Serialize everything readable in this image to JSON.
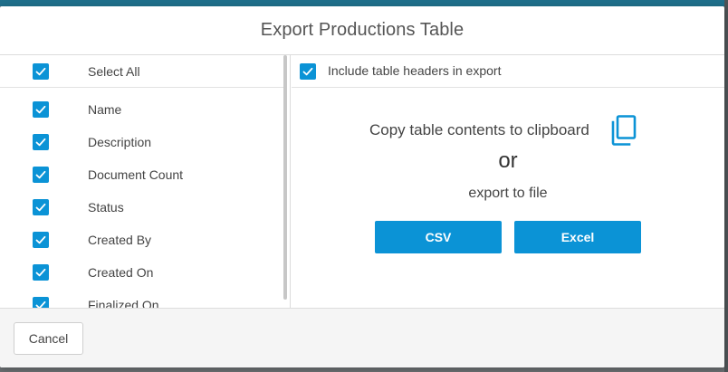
{
  "dialog": {
    "title": "Export Productions Table"
  },
  "columns": {
    "select_all": {
      "label": "Select All",
      "checked": true
    },
    "items": [
      {
        "label": "Name",
        "checked": true
      },
      {
        "label": "Description",
        "checked": true
      },
      {
        "label": "Document Count",
        "checked": true
      },
      {
        "label": "Status",
        "checked": true
      },
      {
        "label": "Created By",
        "checked": true
      },
      {
        "label": "Created On",
        "checked": true
      },
      {
        "label": "Finalized On",
        "checked": true
      }
    ]
  },
  "options": {
    "include_headers_label": "Include table headers in export",
    "include_headers_checked": true
  },
  "export": {
    "copy_text": "Copy table contents to clipboard",
    "copy_icon": "copy-icon",
    "or_text": "or",
    "export_text": "export to file",
    "csv_label": "CSV",
    "excel_label": "Excel"
  },
  "footer": {
    "cancel_label": "Cancel"
  },
  "colors": {
    "accent": "#0b93d6"
  }
}
